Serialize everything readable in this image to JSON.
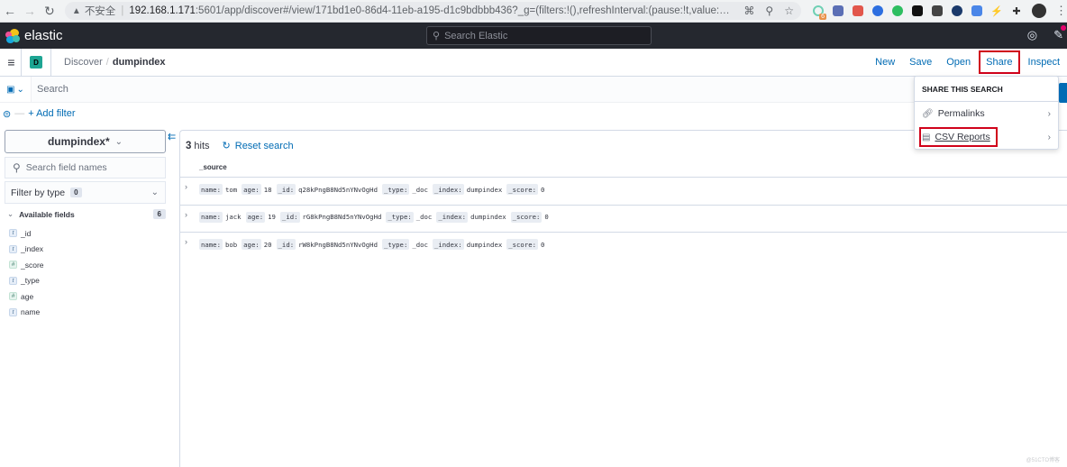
{
  "browser": {
    "insecure_label": "不安全",
    "url_host": "192.168.1.171",
    "url_rest": ":5601/app/discover#/view/171bd1e0-86d4-11eb-a195-d1c9bdbbb436?_g=(filters:!(),refreshInterval:(pause:!t,value:0),time:(from:now-...",
    "extension_badge": "6"
  },
  "header": {
    "brand": "elastic",
    "search_placeholder": "Search Elastic"
  },
  "appbar": {
    "space_initial": "D",
    "breadcrumbs": [
      "Discover",
      "dumpindex"
    ],
    "nav": [
      "New",
      "Save",
      "Open",
      "Share",
      "Inspect"
    ]
  },
  "querybar": {
    "search_placeholder": "Search",
    "add_filter": "+ Add filter"
  },
  "sidebar": {
    "index_pattern": "dumpindex*",
    "field_search_placeholder": "Search field names",
    "filter_by_type": "Filter by type",
    "filter_count": "0",
    "available_fields_label": "Available fields",
    "available_count": "6",
    "fields": [
      {
        "type": "t",
        "name": "_id"
      },
      {
        "type": "t",
        "name": "_index"
      },
      {
        "type": "#",
        "name": "_score"
      },
      {
        "type": "t",
        "name": "_type"
      },
      {
        "type": "#",
        "name": "age"
      },
      {
        "type": "t",
        "name": "name"
      }
    ]
  },
  "main": {
    "hits_count": "3",
    "hits_label": "hits",
    "reset_search": "Reset search",
    "column_header": "_source",
    "rows": [
      [
        [
          "name:",
          "tom"
        ],
        [
          "age:",
          "18"
        ],
        [
          "_id:",
          "q28kPngB8Nd5nYNvOgHd"
        ],
        [
          "_type:",
          "_doc"
        ],
        [
          "_index:",
          "dumpindex"
        ],
        [
          "_score:",
          "0"
        ]
      ],
      [
        [
          "name:",
          "jack"
        ],
        [
          "age:",
          "19"
        ],
        [
          "_id:",
          "rG8kPngB8Nd5nYNvOgHd"
        ],
        [
          "_type:",
          "_doc"
        ],
        [
          "_index:",
          "dumpindex"
        ],
        [
          "_score:",
          "0"
        ]
      ],
      [
        [
          "name:",
          "bob"
        ],
        [
          "age:",
          "20"
        ],
        [
          "_id:",
          "rW8kPngB8Nd5nYNvOgHd"
        ],
        [
          "_type:",
          "_doc"
        ],
        [
          "_index:",
          "dumpindex"
        ],
        [
          "_score:",
          "0"
        ]
      ]
    ]
  },
  "share_popover": {
    "title": "SHARE THIS SEARCH",
    "items": [
      "Permalinks",
      "CSV Reports"
    ]
  },
  "watermark": "@51CTO博客",
  "colors": {
    "accent": "#006bb4",
    "highlight_box": "#d0021b",
    "header_bg": "#25282f"
  }
}
